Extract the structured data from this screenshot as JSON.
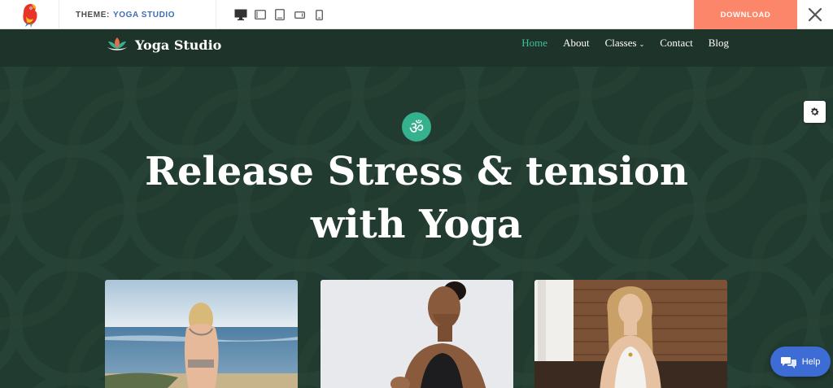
{
  "topbar": {
    "theme_label": "THEME:",
    "theme_name": "YOGA STUDIO",
    "devices": [
      "desktop-icon",
      "tablet-landscape-icon",
      "tablet-portrait-icon",
      "mobile-landscape-icon",
      "mobile-portrait-icon"
    ],
    "download_label": "DOWNLOAD",
    "close_icon": "close-icon"
  },
  "site": {
    "brand": "Yoga Studio",
    "nav": {
      "home": "Home",
      "about": "About",
      "classes": "Classes",
      "contact": "Contact",
      "blog": "Blog"
    },
    "om_symbol": "ॐ",
    "hero_title": "Release Stress & tension with Yoga",
    "help_label": "Help"
  },
  "colors": {
    "accent": "#3ec29c",
    "download": "#fc8669",
    "background": "#223b30",
    "help": "#3d6cd4"
  }
}
